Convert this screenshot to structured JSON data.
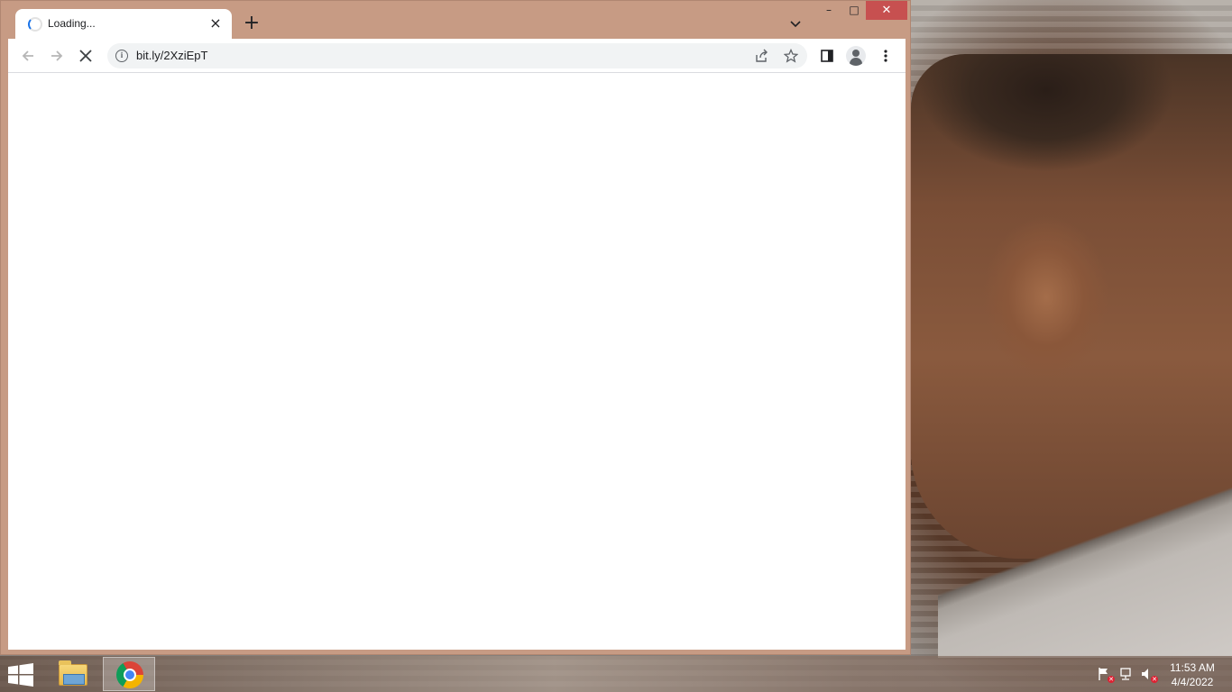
{
  "browser": {
    "tab": {
      "title": "Loading...",
      "close_icon": "close-icon",
      "loading_icon": "loading-spinner-icon"
    },
    "new_tab_icon": "plus-icon",
    "tab_search_icon": "chevron-down-icon",
    "window_controls": {
      "minimize": "–",
      "maximize": "□",
      "close": "✕"
    },
    "toolbar": {
      "back_icon": "arrow-left-icon",
      "forward_icon": "arrow-right-icon",
      "stop_icon": "stop-icon",
      "url": "bit.ly/2XziEpT",
      "site_info_icon": "info-icon",
      "share_icon": "share-icon",
      "bookmark_icon": "star-icon",
      "side_panel_icon": "side-panel-icon",
      "profile_icon": "profile-icon",
      "menu_icon": "more-vertical-icon"
    },
    "content": ""
  },
  "taskbar": {
    "start_icon": "windows-logo-icon",
    "apps": [
      {
        "name": "File Explorer",
        "icon": "folder-icon"
      },
      {
        "name": "Google Chrome",
        "icon": "chrome-icon",
        "active": true
      }
    ],
    "tray": {
      "flag_icon": "action-center-flag-icon",
      "network_icon": "network-icon",
      "volume_icon": "volume-muted-icon"
    },
    "clock": {
      "time": "11:53 AM",
      "date": "4/4/2022"
    }
  },
  "colors": {
    "window_frame": "#c79b84",
    "close_button": "#c75050",
    "omnibox": "#f1f3f4"
  }
}
